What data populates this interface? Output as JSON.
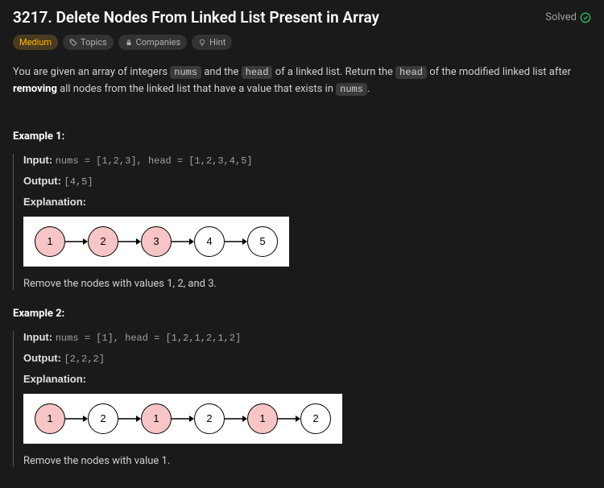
{
  "header": {
    "title": "3217. Delete Nodes From Linked List Present in Array",
    "status": "Solved"
  },
  "pills": {
    "difficulty": "Medium",
    "topics": "Topics",
    "companies": "Companies",
    "hint": "Hint"
  },
  "desc": {
    "p1a": "You are given an array of integers ",
    "c1": "nums",
    "p1b": " and the ",
    "c2": "head",
    "p1c": " of a linked list. Return the ",
    "c3": "head",
    "p1d": " of the modified linked list after ",
    "strong1": "removing",
    "p1e": " all nodes from the linked list that have a value that exists in ",
    "c4": "nums",
    "p1f": "."
  },
  "ex1": {
    "title": "Example 1:",
    "inputLabel": "Input: ",
    "input": "nums = [1,2,3], head = [1,2,3,4,5]",
    "outputLabel": "Output: ",
    "output": "[4,5]",
    "explLabel": "Explanation:",
    "nodes": [
      {
        "v": "1",
        "del": true
      },
      {
        "v": "2",
        "del": true
      },
      {
        "v": "3",
        "del": true
      },
      {
        "v": "4",
        "del": false
      },
      {
        "v": "5",
        "del": false
      }
    ],
    "caption": "Remove the nodes with values 1, 2, and 3."
  },
  "ex2": {
    "title": "Example 2:",
    "inputLabel": "Input: ",
    "input": "nums = [1], head = [1,2,1,2,1,2]",
    "outputLabel": "Output: ",
    "output": "[2,2,2]",
    "explLabel": "Explanation:",
    "nodes": [
      {
        "v": "1",
        "del": true
      },
      {
        "v": "2",
        "del": false
      },
      {
        "v": "1",
        "del": true
      },
      {
        "v": "2",
        "del": false
      },
      {
        "v": "1",
        "del": true
      },
      {
        "v": "2",
        "del": false
      }
    ],
    "caption": "Remove the nodes with value 1."
  }
}
